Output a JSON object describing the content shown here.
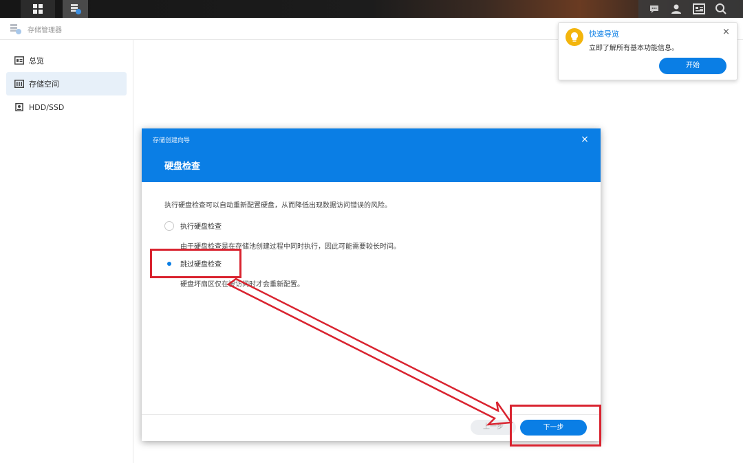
{
  "app": {
    "name": "存储管理器"
  },
  "sidebar": {
    "items": [
      {
        "label": "总览"
      },
      {
        "label": "存储空间"
      },
      {
        "label": "HDD/SSD"
      }
    ]
  },
  "modal": {
    "wizard_title": "存储创建向导",
    "step_title": "硬盘检查",
    "close_symbol": "×",
    "description": "执行硬盘检查可以自动重新配置硬盘，从而降低出现数据访问错误的风险。",
    "options": [
      {
        "label": "执行硬盘检查",
        "hint": "由于硬盘检查是在存储池创建过程中同时执行，因此可能需要较长时间。",
        "selected": false
      },
      {
        "label": "跳过硬盘检查",
        "hint": "硬盘坏扇区仅在被访问时才会重新配置。",
        "selected": true
      }
    ],
    "prev_label": "上一步",
    "next_label": "下一步"
  },
  "toast": {
    "title": "快速导览",
    "message": "立即了解所有基本功能信息。",
    "close_symbol": "×",
    "start_label": "开始"
  },
  "colors": {
    "accent": "#0a7ee5",
    "annotation": "#d9232f",
    "bulb": "#f3b50d"
  },
  "icons": [
    "main-menu-icon",
    "storage-manager-icon",
    "chat-icon",
    "user-icon",
    "widget-icon",
    "search-icon",
    "overview-icon",
    "storage-space-icon",
    "disk-icon",
    "lightbulb-icon",
    "close-icon"
  ]
}
